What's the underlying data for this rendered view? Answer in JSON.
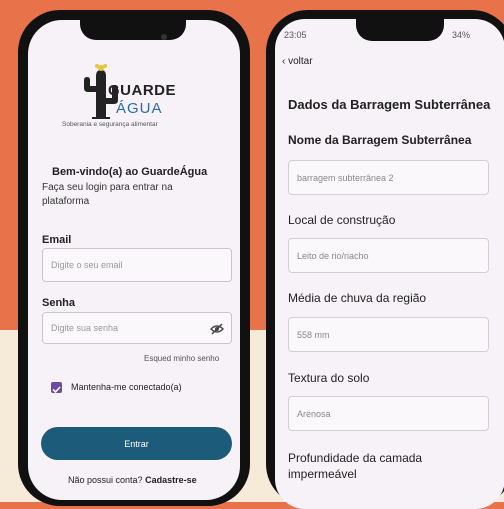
{
  "login": {
    "logo_title": "GUARDE",
    "logo_sub": "ÁGUA",
    "logo_tagline": "Soberania e segurança alimentar",
    "welcome": "Bem-vindo(a) ao GuardeÁgua",
    "subtitle": "Faça seu login para entrar na plataforma",
    "email_label": "Email",
    "email_placeholder": "Digite o seu email",
    "password_label": "Senha",
    "password_placeholder": "Digite sua senha",
    "forgot": "Esqued minho senho",
    "remember": "Mantenha-me conectado(a)",
    "enter_button": "Entrar",
    "no_account": "Não possui conta?",
    "signup": "Cadastre-se"
  },
  "form": {
    "status_time": "23:05",
    "status_battery": "34%",
    "back": "voltar",
    "title": "Dados da Barragem Subterrânea",
    "fields": [
      {
        "label": "Nome da Barragem Subterrânea",
        "value": "barragem subterrânea 2"
      },
      {
        "label": "Local de construção",
        "value": "Leito de rio/riacho"
      },
      {
        "label": "Média de chuva da região",
        "value": "558 mm"
      },
      {
        "label": "Textura do solo",
        "value": "Arenosa"
      },
      {
        "label": "Profundidade da camada impermeável",
        "value": ""
      }
    ]
  },
  "colors": {
    "background_top": "#e8734b",
    "background_bottom": "#f6ead9",
    "primary_button": "#1d5b7b",
    "checkbox": "#6a4ba8"
  }
}
